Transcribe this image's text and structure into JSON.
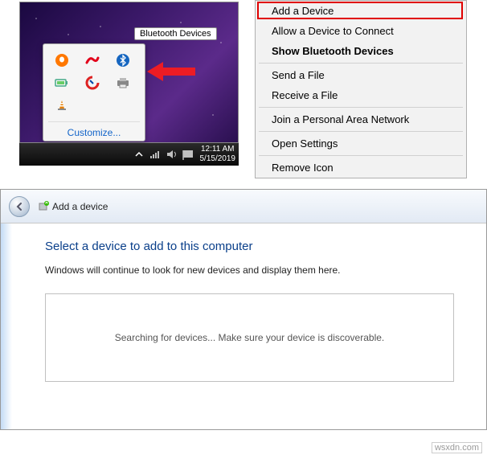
{
  "top": {
    "tooltip": "Bluetooth Devices",
    "customize": "Customize...",
    "clock_time": "12:11 AM",
    "clock_date": "5/15/2019"
  },
  "menu": {
    "add_device": "Add a Device",
    "allow_connect": "Allow a Device to Connect",
    "show_devices": "Show Bluetooth Devices",
    "send_file": "Send a File",
    "receive_file": "Receive a File",
    "join_pan": "Join a Personal Area Network",
    "open_settings": "Open Settings",
    "remove_icon": "Remove Icon"
  },
  "wizard": {
    "title": "Add a device",
    "heading": "Select a device to add to this computer",
    "subtext": "Windows will continue to look for new devices and display them here.",
    "searching": "Searching for devices...  Make sure your device is discoverable."
  },
  "watermark": "wsxdn.com"
}
